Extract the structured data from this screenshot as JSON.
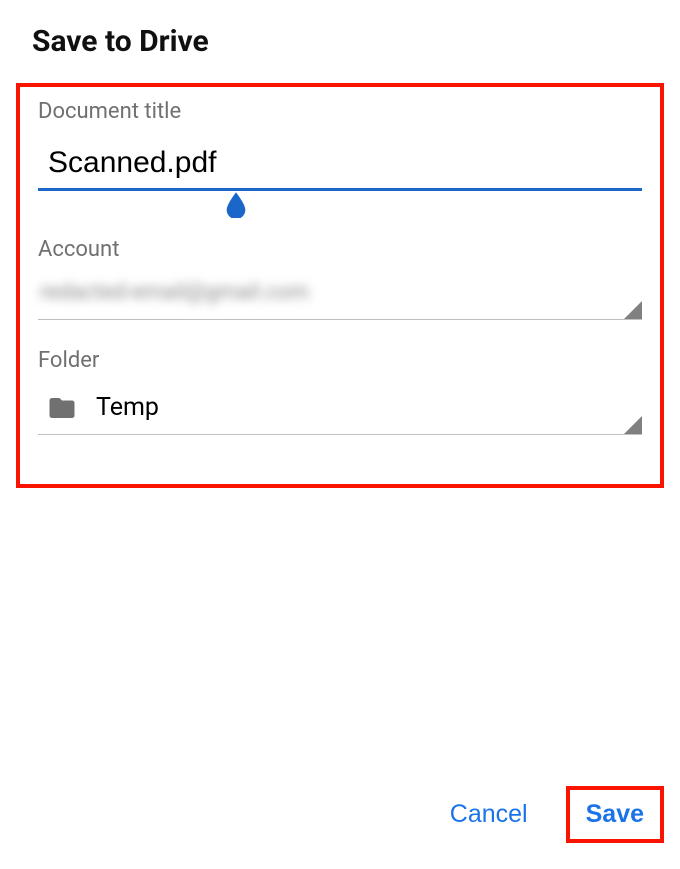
{
  "header": {
    "title": "Save to Drive"
  },
  "form": {
    "document_title": {
      "label": "Document title",
      "value": "Scanned.pdf"
    },
    "account": {
      "label": "Account",
      "value_redacted": "redacted-email@gmail.com"
    },
    "folder": {
      "label": "Folder",
      "value": "Temp"
    }
  },
  "actions": {
    "cancel": "Cancel",
    "save": "Save"
  },
  "colors": {
    "accent": "#1a73e8",
    "highlight_box": "#fa1400",
    "underline_active": "#1b66c9",
    "muted": "#707070"
  }
}
